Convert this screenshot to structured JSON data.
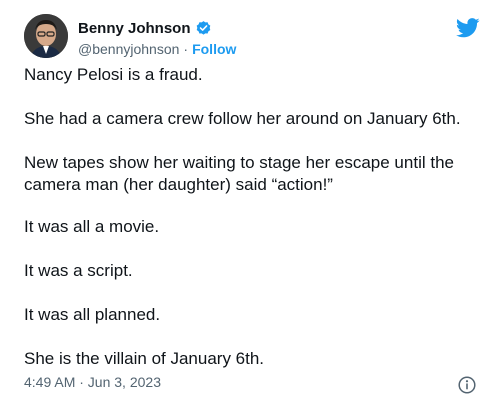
{
  "author": {
    "display_name": "Benny Johnson",
    "handle": "@bennyjohnson",
    "separator": "·",
    "follow_label": "Follow",
    "verified_icon": "verified-badge-icon",
    "avatar_icon": "avatar"
  },
  "brand": {
    "logo_icon": "twitter-bird-icon",
    "accent": "#1d9bf0"
  },
  "tweet": {
    "paragraphs": [
      "Nancy Pelosi is a fraud.",
      "She had a camera crew follow her around on January 6th.",
      "New tapes show her waiting to stage her escape until the camera man (her daughter) said “action!”",
      "It was all a movie.",
      "It was a script.",
      "It was all planned.",
      "She is the villain of January 6th."
    ],
    "timestamp": "4:49 AM · Jun 3, 2023",
    "info_icon": "info-icon"
  },
  "colors": {
    "text_primary": "#0f1419",
    "text_secondary": "#536471"
  }
}
